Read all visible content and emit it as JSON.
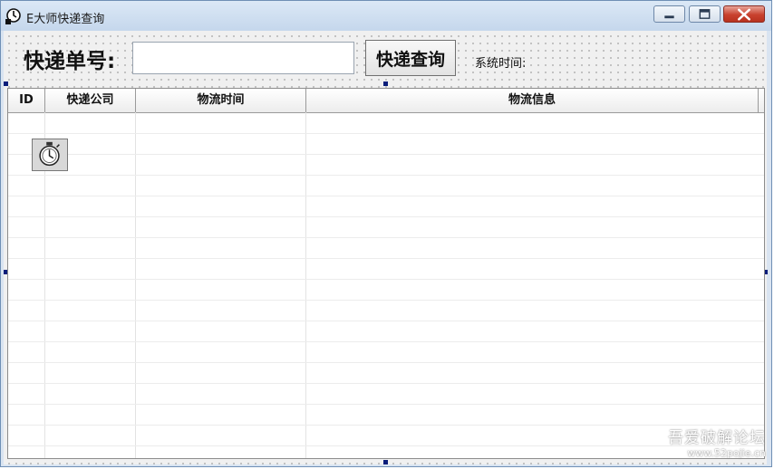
{
  "window": {
    "title": "E大师快递查询",
    "icon": "clock-icon",
    "controls": [
      "minimize",
      "maximize",
      "close"
    ]
  },
  "form": {
    "tracking_label": "快递单号:",
    "tracking_value": "",
    "query_button": "快递查询",
    "time_label": "系统时间:"
  },
  "table": {
    "columns": [
      "ID",
      "快递公司",
      "物流时间",
      "物流信息"
    ],
    "rows": []
  },
  "timer": {
    "icon": "stopwatch-icon"
  },
  "watermark": {
    "line1": "吾爱破解论坛",
    "line2": "www.52pojie.cn"
  },
  "colors": {
    "titlebar": "#c9dbee",
    "close_button": "#c8412e",
    "selection_handle": "#0a1d7a"
  }
}
